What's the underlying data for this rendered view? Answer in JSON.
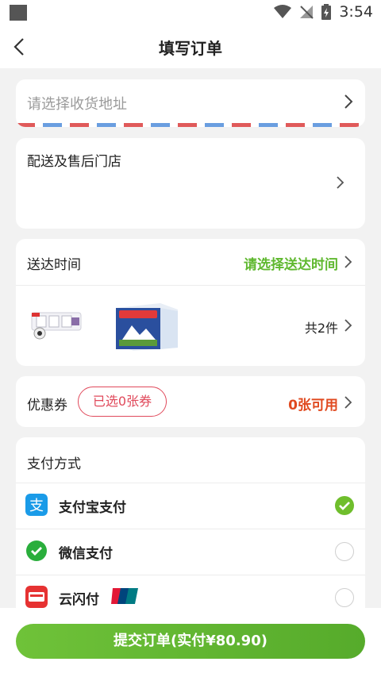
{
  "status_bar": {
    "time": "3:54"
  },
  "header": {
    "title": "填写订单"
  },
  "address": {
    "placeholder": "请选择收货地址"
  },
  "store": {
    "label": "配送及售后门店"
  },
  "delivery": {
    "label": "送达时间",
    "value": "请选择送达时间",
    "items_count": "共2件"
  },
  "coupon": {
    "label": "优惠券",
    "selected": "已选0张券",
    "available": "0张可用"
  },
  "payment": {
    "title": "支付方式",
    "methods": [
      {
        "name": "支付宝支付",
        "icon": "alipay-icon",
        "selected": true
      },
      {
        "name": "微信支付",
        "icon": "wechat-pay-icon",
        "selected": false
      },
      {
        "name": "云闪付",
        "icon": "quickpass-icon",
        "selected": false
      }
    ]
  },
  "footer": {
    "submit_label": "提交订单(实付¥80.90)"
  },
  "colors": {
    "accent_green": "#5fb82f",
    "coupon_red": "#e0495b",
    "available_red": "#e0491f"
  }
}
